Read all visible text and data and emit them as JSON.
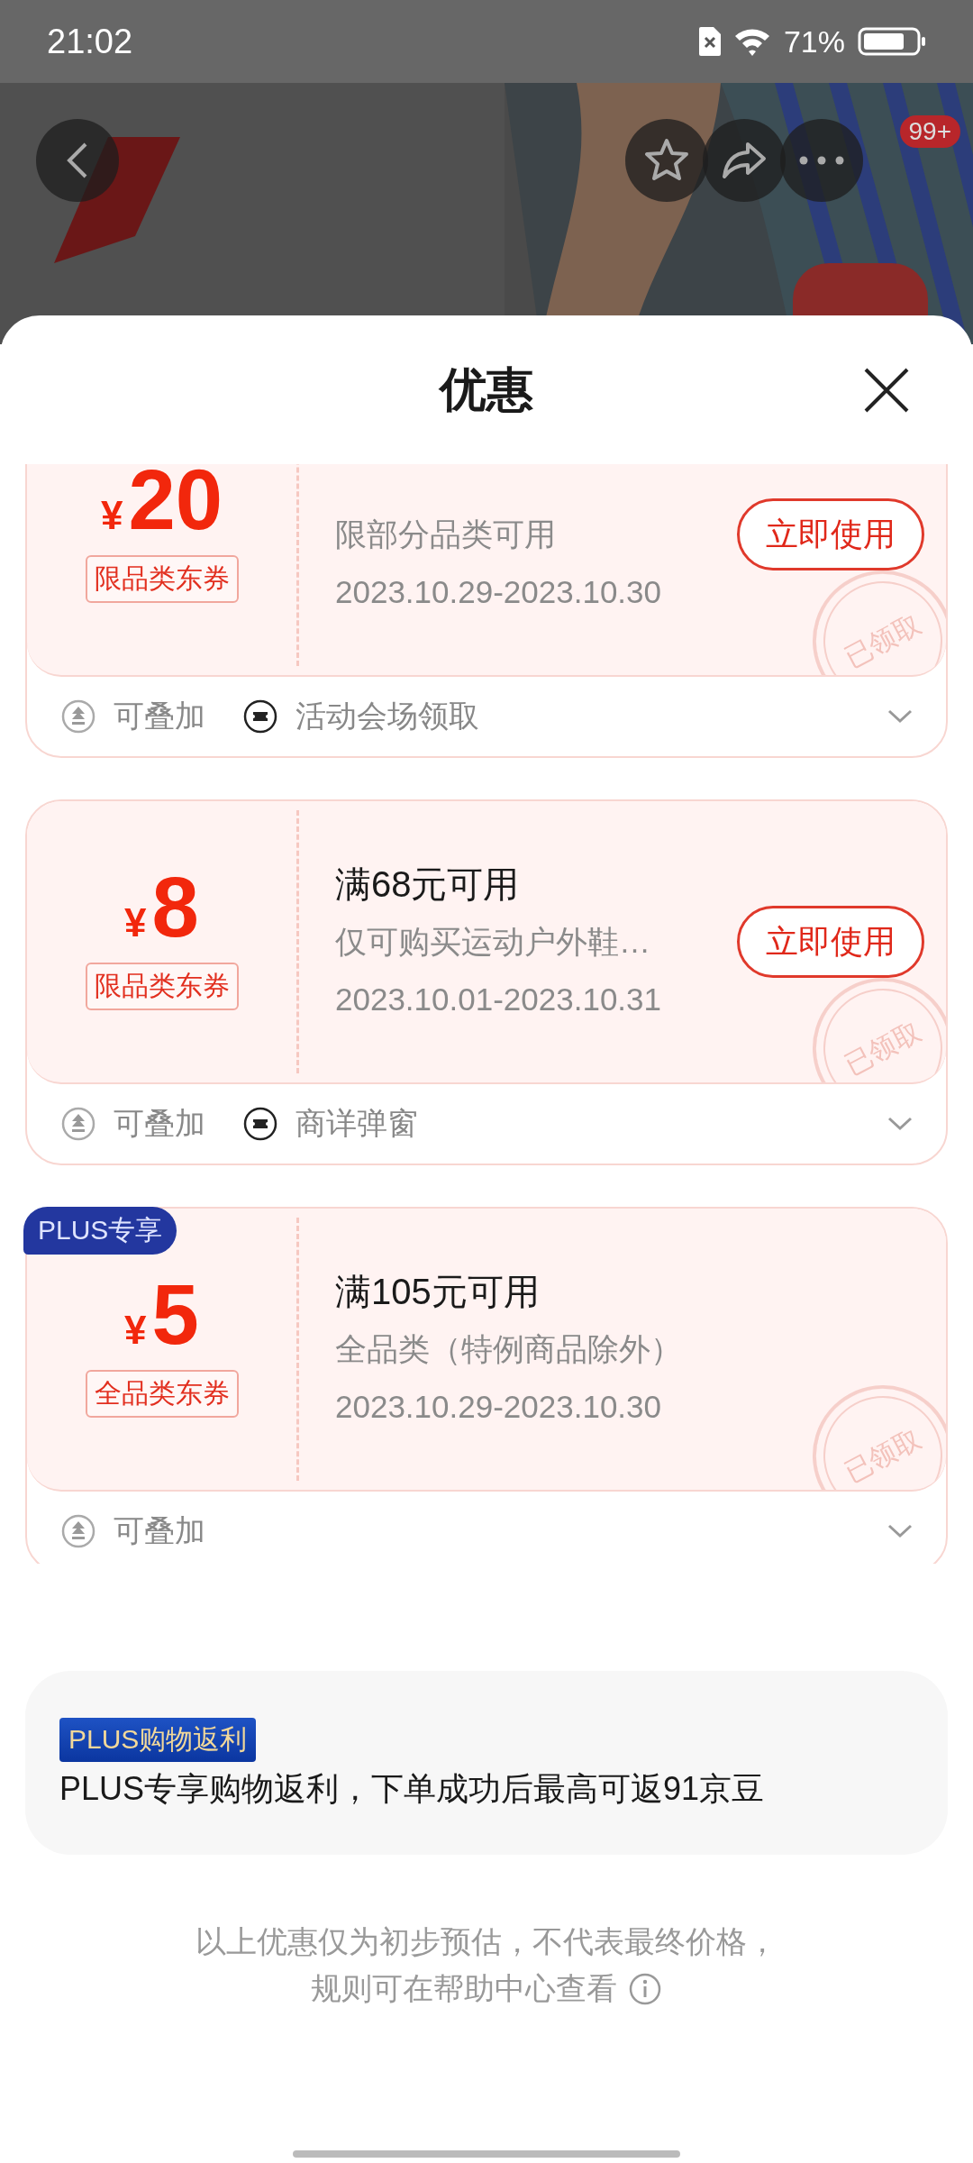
{
  "status_bar": {
    "time": "21:02",
    "battery": "71%"
  },
  "top_bar": {
    "more_badge": "99+"
  },
  "sheet": {
    "title": "优惠"
  },
  "coupons": [
    {
      "currency": "¥",
      "amount": "20",
      "tag": "限品类东券",
      "desc": "限部分品类可用",
      "dates": "2023.10.29-2023.10.30",
      "action": "立即使用",
      "stamp": "已领取",
      "footer": [
        {
          "kind": "stack",
          "label": "可叠加"
        },
        {
          "kind": "ticket",
          "label": "活动会场领取"
        }
      ]
    },
    {
      "currency": "¥",
      "amount": "8",
      "tag": "限品类东券",
      "title": "满68元可用",
      "desc": "仅可购买运动户外鞋…",
      "dates": "2023.10.01-2023.10.31",
      "action": "立即使用",
      "stamp": "已领取",
      "footer": [
        {
          "kind": "stack",
          "label": "可叠加"
        },
        {
          "kind": "ticket",
          "label": "商详弹窗"
        }
      ]
    },
    {
      "badge": "PLUS专享",
      "currency": "¥",
      "amount": "5",
      "tag": "全品类东券",
      "title": "满105元可用",
      "desc": "全品类（特例商品除外）",
      "dates": "2023.10.29-2023.10.30",
      "stamp": "已领取",
      "footer": [
        {
          "kind": "stack",
          "label": "可叠加"
        }
      ]
    }
  ],
  "plus_rebate": {
    "badge": "PLUS购物返利",
    "text": "PLUS专享购物返利，下单成功后最高可返91京豆"
  },
  "disclaimer": [
    "以上优惠仅为初步预估，不代表最终价格，",
    "规则可在帮助中心查看"
  ]
}
